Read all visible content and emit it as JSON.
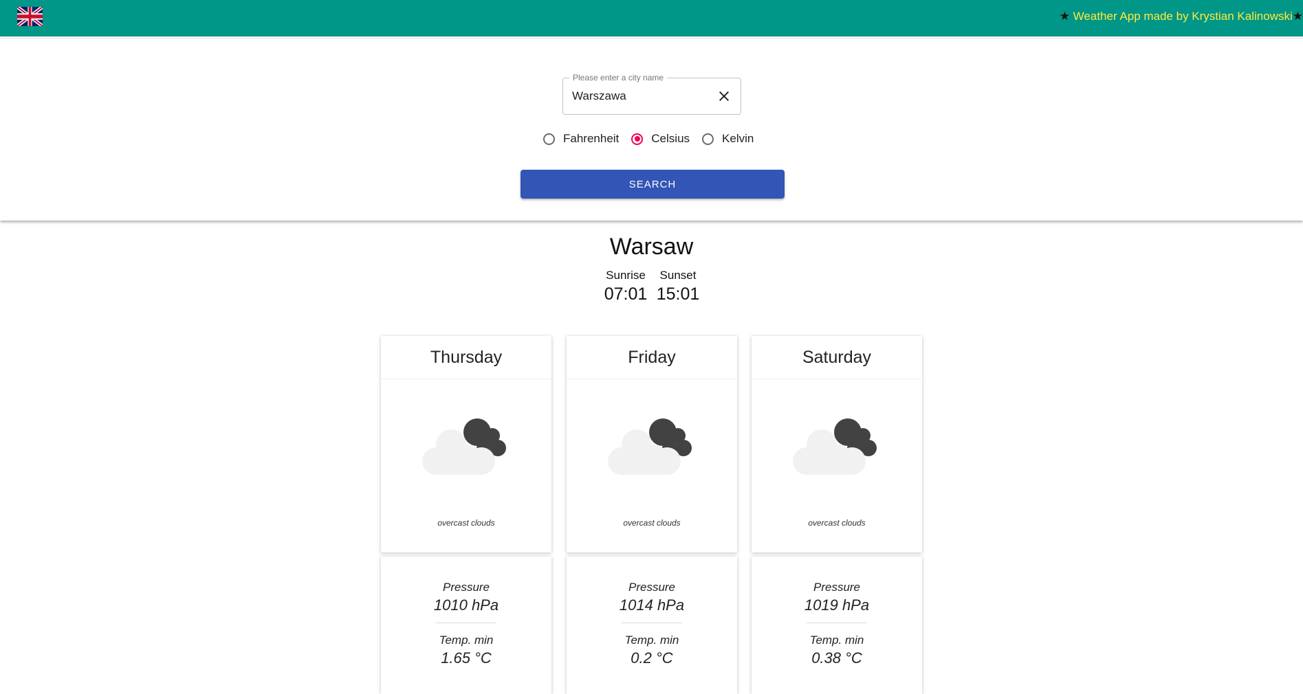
{
  "header": {
    "language_flag_icon": "uk-flag-icon",
    "star_left": "★",
    "credit_text": " Weather App made by Krystian Kalinowski",
    "star_right": "★",
    "background_color": "#009688",
    "credit_color": "#ffeb3b"
  },
  "search": {
    "field_label": "Please enter a city name",
    "field_value": "Warszawa",
    "clear_icon": "close-icon",
    "units": [
      {
        "label": "Fahrenheit",
        "selected": false
      },
      {
        "label": "Celsius",
        "selected": true
      },
      {
        "label": "Kelvin",
        "selected": false
      }
    ],
    "button_label": "SEARCH",
    "button_color": "#3355b5",
    "radio_accent_color": "#f50057"
  },
  "city": {
    "name": "Warsaw",
    "sunrise_label": "Sunrise",
    "sunrise_time": "07:01",
    "sunset_label": "Sunset",
    "sunset_time": "15:01"
  },
  "days": [
    {
      "day": "Thursday",
      "icon": "overcast-clouds-icon",
      "description": "overcast clouds",
      "pressure_label": "Pressure",
      "pressure_value": "1010 hPa",
      "temp_min_label": "Temp. min",
      "temp_min_value": "1.65 °C"
    },
    {
      "day": "Friday",
      "icon": "overcast-clouds-icon",
      "description": "overcast clouds",
      "pressure_label": "Pressure",
      "pressure_value": "1014 hPa",
      "temp_min_label": "Temp. min",
      "temp_min_value": "0.2 °C"
    },
    {
      "day": "Saturday",
      "icon": "overcast-clouds-icon",
      "description": "overcast clouds",
      "pressure_label": "Pressure",
      "pressure_value": "1019 hPa",
      "temp_min_label": "Temp. min",
      "temp_min_value": "0.38 °C"
    }
  ]
}
